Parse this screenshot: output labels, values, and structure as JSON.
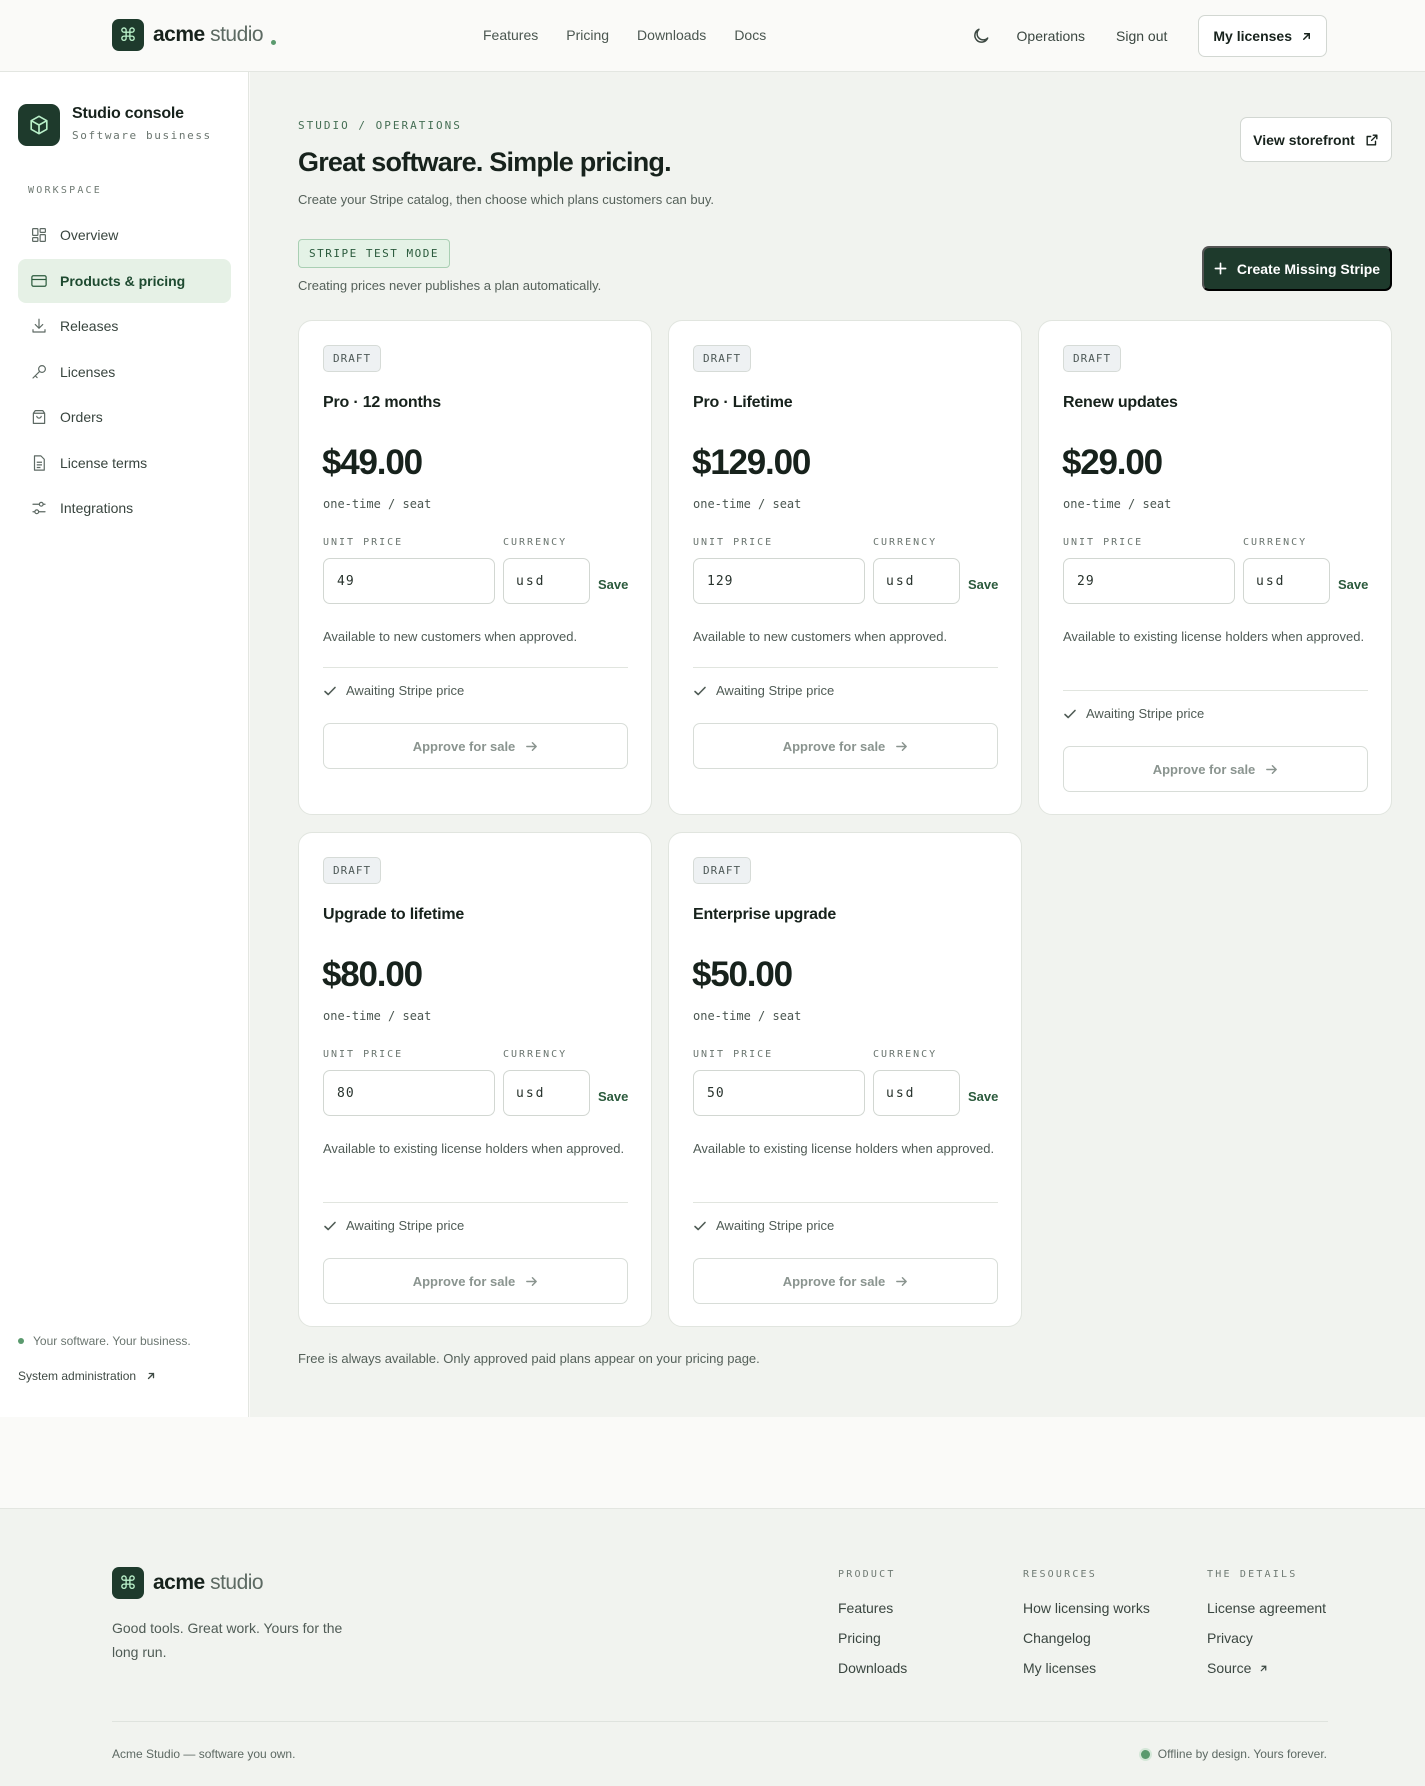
{
  "nav": {
    "brand_bold": "acme",
    "brand_light": "studio",
    "links": [
      "Features",
      "Pricing",
      "Downloads",
      "Docs"
    ],
    "operations": "Operations",
    "sign_out": "Sign out",
    "my_licenses": "My licenses"
  },
  "sidebar": {
    "title": "Studio console",
    "subtitle": "Software business",
    "section": "WORKSPACE",
    "items": [
      {
        "label": "Overview",
        "icon": "grid-icon"
      },
      {
        "label": "Products & pricing",
        "icon": "card-icon",
        "active": true
      },
      {
        "label": "Releases",
        "icon": "download-icon"
      },
      {
        "label": "Licenses",
        "icon": "key-icon"
      },
      {
        "label": "Orders",
        "icon": "bag-icon"
      },
      {
        "label": "License terms",
        "icon": "document-icon"
      },
      {
        "label": "Integrations",
        "icon": "sliders-icon"
      }
    ],
    "footer_tagline": "Your software. Your business.",
    "footer_link": "System administration"
  },
  "main": {
    "breadcrumb": "STUDIO / OPERATIONS",
    "title": "Great software. Simple pricing.",
    "subtitle": "Create your Stripe catalog, then choose which plans customers can buy.",
    "view_storefront": "View storefront",
    "test_mode": "STRIPE TEST MODE",
    "test_note": "Creating prices never publishes a plan automatically.",
    "create_button": "Create Missing Stripe",
    "unit_label": "UNIT PRICE",
    "currency_label": "CURRENCY",
    "save_label": "Save",
    "await_label": "Awaiting Stripe price",
    "approve_label": "Approve for sale",
    "cards": [
      {
        "badge": "DRAFT",
        "title": "Pro · 12 months",
        "price": "$49.00",
        "per": "one-time / seat",
        "unit": "49",
        "currency": "usd",
        "availability": "Available to new customers when approved."
      },
      {
        "badge": "DRAFT",
        "title": "Pro · Lifetime",
        "price": "$129.00",
        "per": "one-time / seat",
        "unit": "129",
        "currency": "usd",
        "availability": "Available to new customers when approved."
      },
      {
        "badge": "DRAFT",
        "title": "Renew updates",
        "price": "$29.00",
        "per": "one-time / seat",
        "unit": "29",
        "currency": "usd",
        "availability": "Available to existing license holders when approved."
      },
      {
        "badge": "DRAFT",
        "title": "Upgrade to lifetime",
        "price": "$80.00",
        "per": "one-time / seat",
        "unit": "80",
        "currency": "usd",
        "availability": "Available to existing license holders when approved."
      },
      {
        "badge": "DRAFT",
        "title": "Enterprise upgrade",
        "price": "$50.00",
        "per": "one-time / seat",
        "unit": "50",
        "currency": "usd",
        "availability": "Available to existing license holders when approved."
      }
    ],
    "free_note": "Free is always available. Only approved paid plans appear on your pricing page."
  },
  "footer": {
    "brand_bold": "acme",
    "brand_light": "studio",
    "tagline": "Good tools. Great work. Yours for the long run.",
    "columns": [
      {
        "heading": "PRODUCT",
        "links": [
          "Features",
          "Pricing",
          "Downloads"
        ]
      },
      {
        "heading": "RESOURCES",
        "links": [
          "How licensing works",
          "Changelog",
          "My licenses"
        ]
      },
      {
        "heading": "THE DETAILS",
        "links": [
          "License agreement",
          "Privacy",
          "Source"
        ]
      }
    ],
    "bottom_left": "Acme Studio — software you own.",
    "bottom_right": "Offline by design. Yours forever."
  }
}
